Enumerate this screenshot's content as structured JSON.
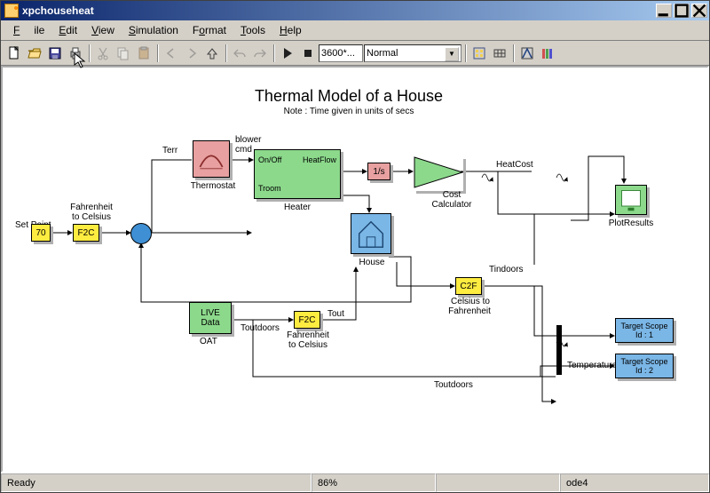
{
  "window": {
    "title": "xpchouseheat"
  },
  "menu": {
    "file": "File",
    "edit": "Edit",
    "view": "View",
    "simulation": "Simulation",
    "format": "Format",
    "tools": "Tools",
    "help": "Help"
  },
  "toolbar": {
    "stop_time": "3600*...",
    "mode": "Normal"
  },
  "title": "Thermal Model of a House",
  "subtitle": "Note : Time given in units of secs",
  "blocks": {
    "set_point_value": "70",
    "set_point_label": "Set Point",
    "f2c1": "F2C",
    "f2c1_label_top": "Fahrenheit",
    "f2c1_label_bot": "to Celsius",
    "thermostat": "Thermostat",
    "terr": "Terr",
    "blower": "blower",
    "blower2": "cmd",
    "heater": "Heater",
    "heater_onoff": "On/Off",
    "heater_heatflow": "HeatFlow",
    "heater_troom": "Troom",
    "integrator": "1/s",
    "cost": "cost",
    "cost_label1": "Cost",
    "cost_label2": "Calculator",
    "heatcost": "HeatCost",
    "plot": "PlotResults",
    "house": "House",
    "c2f": "C2F",
    "c2f_label1": "Celsius to",
    "c2f_label2": "Fahrenheit",
    "tindoors": "Tindoors",
    "oat1": "LIVE",
    "oat2": "Data",
    "oat_label": "OAT",
    "toutdoors": "Toutdoors",
    "f2c2": "F2C",
    "f2c2_top": "Fahrenheit",
    "f2c2_bot": "to Celsius",
    "tout": "Tout",
    "temperatures": "Temperatures",
    "toutdoors2": "Toutdoors",
    "scope1a": "Target Scope",
    "scope1b": "Id : 1",
    "scope2a": "Target Scope",
    "scope2b": "Id : 2"
  },
  "status": {
    "ready": "Ready",
    "zoom": "86%",
    "blank": "",
    "solver": "ode4"
  }
}
